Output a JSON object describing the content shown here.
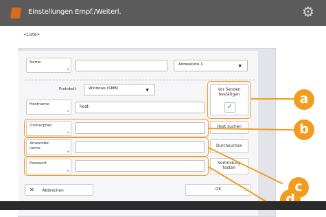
{
  "window": {
    "title": "Einstellungen Empf./Weiterl.",
    "icon": "app-icon",
    "settings_icon": "gear-icon"
  },
  "breadcrumb": "<Liste>",
  "form": {
    "name_label": "Name",
    "name_value": "",
    "address_list_value": "Adressliste 1",
    "protocol_label": "Protokoll:",
    "protocol_value": "Windows (SMB)",
    "hostname_label": "Hostname",
    "hostname_value": "host",
    "folder_label": "Ordnerpfad",
    "folder_value": "",
    "username_label": "Anwender-\nname",
    "username_value": "",
    "password_label": "Passwort",
    "password_value": ""
  },
  "side_buttons": {
    "confirm_before_send_label": "Vor Senden\nbestätigen",
    "confirm_checked": true,
    "search_host_label": "Host suchen",
    "browse_label": "Durchsuchen",
    "connection_test_label": "Verbindung\ntesten"
  },
  "footer": {
    "cancel_label": "Abbrechen",
    "ok_label": "OK"
  },
  "callouts": [
    "a",
    "b",
    "c",
    "d"
  ],
  "colors": {
    "accent": "#f29b1d",
    "titlebar": "#5b5b5b",
    "check": "#3aa845"
  }
}
